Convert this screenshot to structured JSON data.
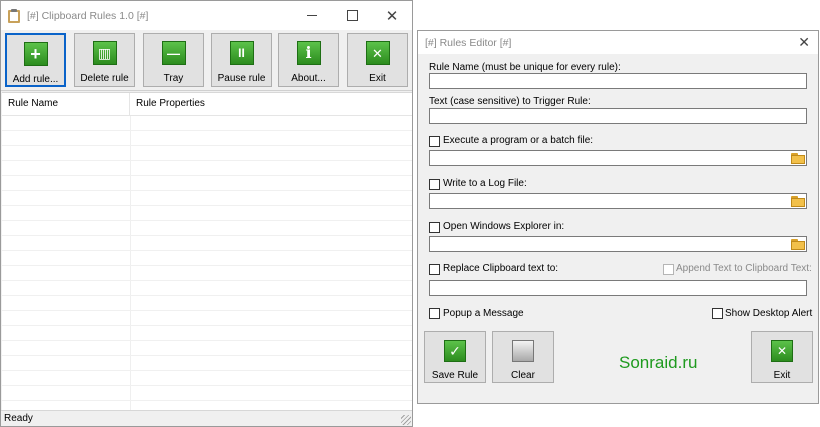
{
  "main_window": {
    "title": "[#] Clipboard Rules 1.0 [#]",
    "toolbar": [
      {
        "label": "Add rule...",
        "icon": "plus-icon",
        "glyph": "+"
      },
      {
        "label": "Delete rule",
        "icon": "trash-icon",
        "glyph": "▥"
      },
      {
        "label": "Tray",
        "icon": "minus-icon",
        "glyph": "—"
      },
      {
        "label": "Pause rule",
        "icon": "pause-icon",
        "glyph": "II"
      },
      {
        "label": "About...",
        "icon": "info-icon",
        "glyph": "i"
      },
      {
        "label": "Exit",
        "icon": "exit-x-icon",
        "glyph": "✕"
      }
    ],
    "columns": {
      "rule_name": "Rule Name",
      "rule_properties": "Rule Properties"
    },
    "status": "Ready"
  },
  "editor": {
    "title": "[#] Rules Editor [#]",
    "rule_name_label": "Rule Name (must be unique for every rule):",
    "rule_name_value": "",
    "trigger_label": "Text (case sensitive) to Trigger Rule:",
    "trigger_value": "",
    "execute_label": "Execute a program or a batch file:",
    "execute_value": "",
    "log_label": "Write to a Log File:",
    "log_value": "",
    "explorer_label": "Open Windows Explorer in:",
    "explorer_value": "",
    "replace_label": "Replace Clipboard text to:",
    "append_label": "Append Text to Clipboard Text:",
    "replace_value": "",
    "popup_label": "Popup a Message",
    "desktop_alert_label": "Show Desktop Alert",
    "save_label": "Save Rule",
    "clear_label": "Clear",
    "exit_label": "Exit",
    "brand": "Sonraid.ru"
  },
  "colors": {
    "accent": "#0a63c9",
    "brand": "#1e9a1e"
  }
}
